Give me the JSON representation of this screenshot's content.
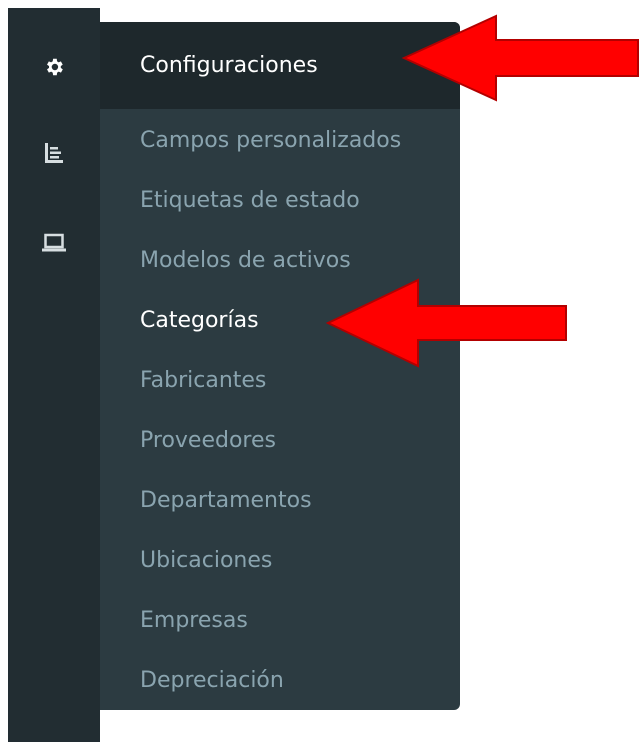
{
  "sidebar": {
    "icons": [
      {
        "name": "gear-icon"
      },
      {
        "name": "bar-chart-icon"
      },
      {
        "name": "laptop-icon"
      }
    ]
  },
  "flyout": {
    "header_label": "Configuraciones",
    "items": [
      {
        "label": "Campos personalizados",
        "active": false
      },
      {
        "label": "Etiquetas de estado",
        "active": false
      },
      {
        "label": "Modelos de activos",
        "active": false
      },
      {
        "label": "Categorías",
        "active": true
      },
      {
        "label": "Fabricantes",
        "active": false
      },
      {
        "label": "Proveedores",
        "active": false
      },
      {
        "label": "Departamentos",
        "active": false
      },
      {
        "label": "Ubicaciones",
        "active": false
      },
      {
        "label": "Empresas",
        "active": false
      },
      {
        "label": "Depreciación",
        "active": false
      }
    ]
  },
  "colors": {
    "sidebar_bg": "#222d32",
    "flyout_bg": "#2c3b41",
    "header_bg": "#1e282c",
    "item_text": "#8aa4af",
    "active_text": "#ffffff",
    "arrow": "#ff0000"
  },
  "annotations": [
    {
      "name": "red-arrow-icon",
      "points_to": "Configuraciones"
    },
    {
      "name": "red-arrow-icon",
      "points_to": "Categorías"
    }
  ]
}
